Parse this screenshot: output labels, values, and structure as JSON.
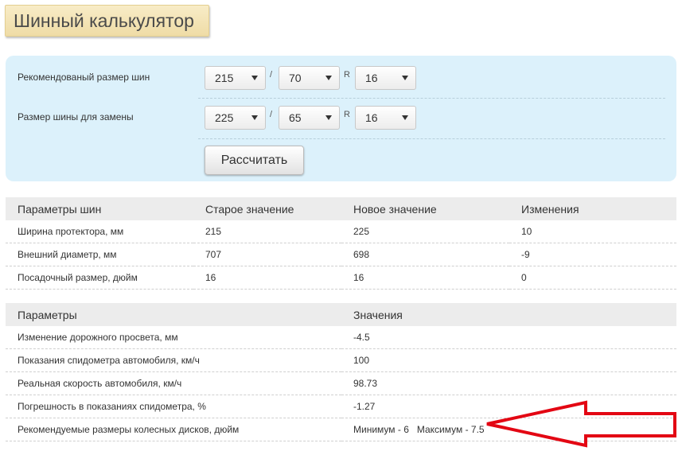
{
  "page_title": "Шинный калькулятор",
  "form": {
    "row1": {
      "label": "Рекомендованый размер шин",
      "width": "215",
      "profile": "70",
      "radius": "16"
    },
    "row2": {
      "label": "Размер шины для замены",
      "width": "225",
      "profile": "65",
      "radius": "16"
    },
    "slash": "/",
    "r_letter": "R",
    "calculate_label": "Рассчитать"
  },
  "tire_table": {
    "headers": [
      "Параметры шин",
      "Старое значение",
      "Новое значение",
      "Изменения"
    ],
    "rows": [
      [
        "Ширина протектора, мм",
        "215",
        "225",
        "10"
      ],
      [
        "Внешний диаметр, мм",
        "707",
        "698",
        "-9"
      ],
      [
        "Посадочный размер, дюйм",
        "16",
        "16",
        "0"
      ]
    ]
  },
  "param_table": {
    "headers": [
      "Параметры",
      "Значения"
    ],
    "rows": [
      [
        "Изменение дорожного просвета, мм",
        "-4.5"
      ],
      [
        "Показания спидометра автомобиля, км/ч",
        "100"
      ],
      [
        "Реальная скорость автомобиля, км/ч",
        "98.73"
      ],
      [
        "Погрешность в показаниях спидометра, %",
        "-1.27"
      ],
      [
        "Рекомендуемые размеры колесных дисков, дюйм",
        "Минимум - 6   Максимум - 7.5"
      ]
    ]
  },
  "colors": {
    "panel_bg": "#dcf1fb",
    "title_bg": "#f3e4b5",
    "arrow": "#e30613"
  },
  "icons": {
    "select_arrow": "dropdown-triangle-icon",
    "annotation": "red-arrow-icon"
  }
}
